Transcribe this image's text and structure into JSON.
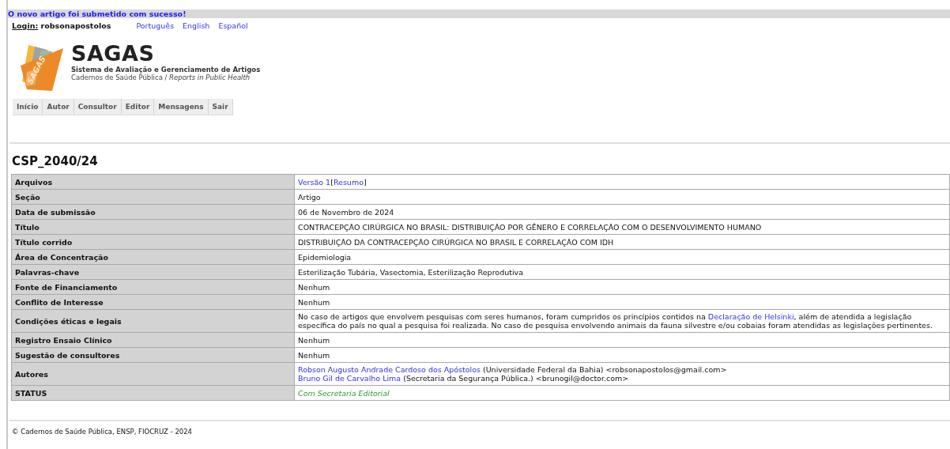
{
  "message": "O novo artigo foi submetido com sucesso!",
  "login": {
    "label": "Login:",
    "user": "robsonapostolos"
  },
  "languages": [
    "Português",
    "English",
    "Español"
  ],
  "logo": {
    "mark": "SAGAS",
    "name": "SAGAS",
    "subtitle": "Sistema de Avaliação e Gerenciamento de Artigos",
    "tagline_pt": "Cadernos de Saúde Pública /",
    "tagline_en": "Reports in Public Health"
  },
  "menu": [
    "Início",
    "Autor",
    "Consultor",
    "Editor",
    "Mensagens",
    "Sair"
  ],
  "title": "CSP_2040/24",
  "rows": [
    {
      "label": "Arquivos",
      "kind": "plain",
      "lines": [
        [
          {
            "text": "Versão 1",
            "link": true
          },
          {
            "text": "[",
            "link": false
          },
          {
            "text": "Resumo",
            "link": true
          },
          {
            "text": "]",
            "link": false
          }
        ]
      ]
    },
    {
      "label": "Seção",
      "kind": "plain",
      "lines": [
        [
          {
            "text": "Artigo",
            "link": false
          }
        ]
      ]
    },
    {
      "label": "Data de submissão",
      "kind": "plain",
      "lines": [
        [
          {
            "text": "06 de Novembro de 2024",
            "link": false
          }
        ]
      ]
    },
    {
      "label": "Título",
      "kind": "plain",
      "lines": [
        [
          {
            "text": "CONTRACEPÇÃO CIRÚRGICA NO BRASIL: DISTRIBUIÇÃO POR GÊNERO E CORRELAÇÃO COM O DESENVOLVIMENTO HUMANO",
            "link": false
          }
        ]
      ]
    },
    {
      "label": "Título corrido",
      "kind": "plain",
      "lines": [
        [
          {
            "text": "DISTRIBUIÇÃO DA CONTRACEPÇÃO CIRÚRGICA NO BRASIL E CORRELAÇÃO COM IDH",
            "link": false
          }
        ]
      ]
    },
    {
      "label": "Área de Concentração",
      "kind": "plain",
      "lines": [
        [
          {
            "text": "Epidemiologia",
            "link": false
          }
        ]
      ]
    },
    {
      "label": "Palavras-chave",
      "kind": "plain",
      "lines": [
        [
          {
            "text": "Esterilização Tubária, Vasectomia, Esterilização Reprodutiva",
            "link": false
          }
        ]
      ]
    },
    {
      "label": "Fonte de Financiamento",
      "kind": "plain",
      "lines": [
        [
          {
            "text": "Nenhum",
            "link": false
          }
        ]
      ]
    },
    {
      "label": "Conflito de Interesse",
      "kind": "plain",
      "lines": [
        [
          {
            "text": "Nenhum",
            "link": false
          }
        ]
      ]
    },
    {
      "label": "Condições éticas e legais",
      "kind": "plain",
      "lines": [
        [
          {
            "text": "No caso de artigos que envolvem pesquisas com seres humanos, foram cumpridos os princípios contidos na ",
            "link": false
          },
          {
            "text": "Declaração de Helsinki",
            "link": true
          },
          {
            "text": ", além de atendida a legislação específica do país no qual a pesquisa foi realizada. No caso de pesquisa envolvendo animais da fauna silvestre e/ou cobaias foram atendidas as legislações pertinentes.",
            "link": false
          }
        ]
      ]
    },
    {
      "label": "Registro Ensaio Clínico",
      "kind": "plain",
      "lines": [
        [
          {
            "text": "Nenhum",
            "link": false
          }
        ]
      ]
    },
    {
      "label": "Sugestão de consultores",
      "kind": "plain",
      "lines": [
        [
          {
            "text": "Nenhum",
            "link": false
          }
        ]
      ]
    },
    {
      "label": "Autores",
      "kind": "plain",
      "lines": [
        [
          {
            "text": "Robson Augusto Andrade Cardoso dos Apóstolos",
            "link": true
          },
          {
            "text": " (Universidade Federal da Bahia) <robsonapostolos@gmail.com>",
            "link": false
          }
        ],
        [
          {
            "text": "Bruno Gil de Carvalho Lima",
            "link": true
          },
          {
            "text": " (Secretaria da Segurança Pública.) <brunogil@doctor.com>",
            "link": false
          }
        ]
      ]
    },
    {
      "label": "STATUS",
      "kind": "status",
      "lines": [
        [
          {
            "text": "Com Secretaria Editorial",
            "link": false
          }
        ]
      ]
    }
  ],
  "footer": "© Cadernos de Saúde Pública, ENSP, FIOCRUZ - 2024"
}
